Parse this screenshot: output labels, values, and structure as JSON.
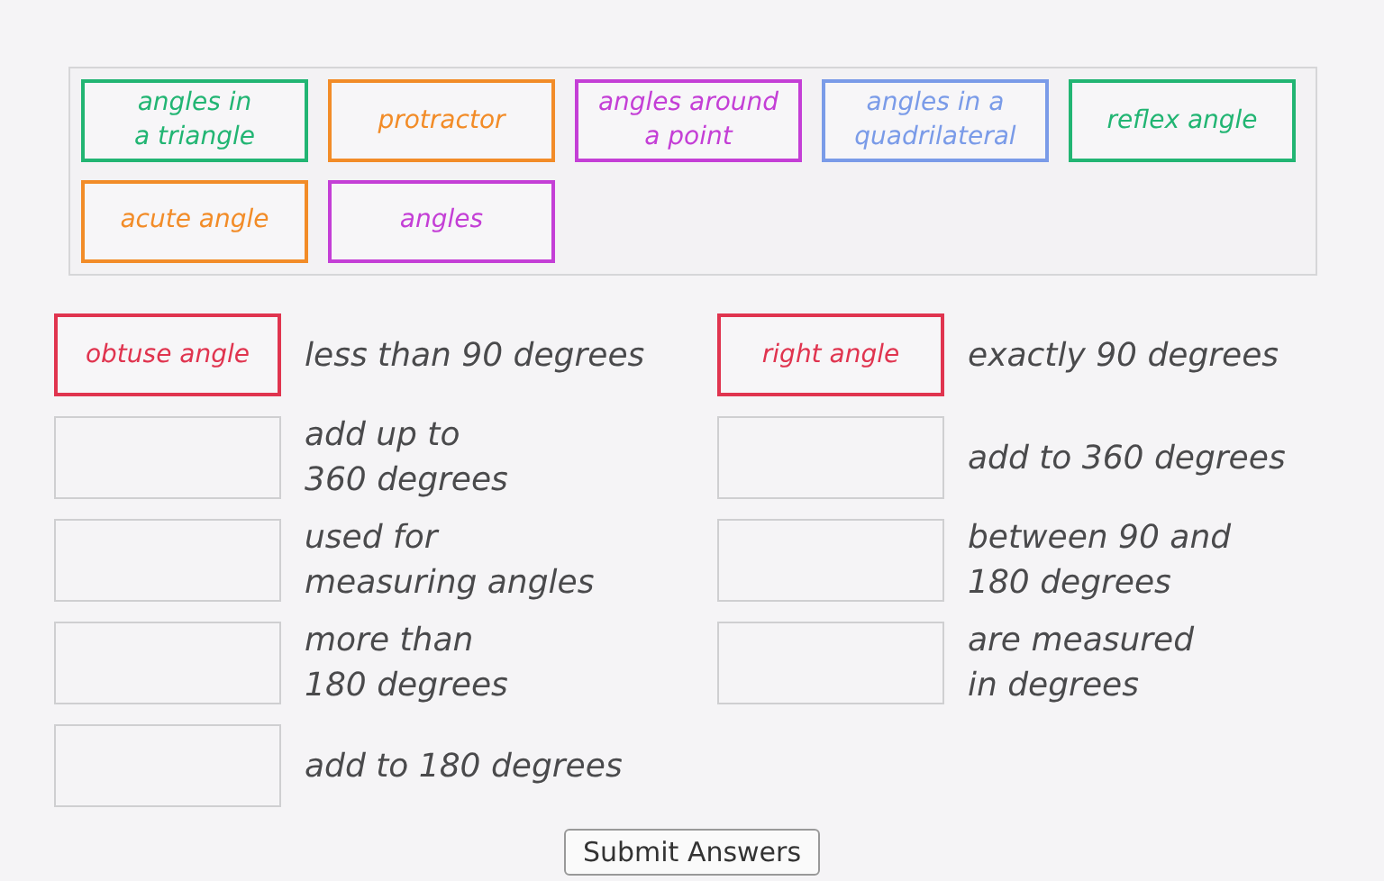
{
  "bank": [
    {
      "label": "angles in\na triangle",
      "color": "#22b573"
    },
    {
      "label": "protractor",
      "color": "#f28c28"
    },
    {
      "label": "angles around\na point",
      "color": "#c43fd6"
    },
    {
      "label": "angles in a\nquadrilateral",
      "color": "#7a9be8"
    },
    {
      "label": "reflex angle",
      "color": "#22b573"
    },
    {
      "label": "acute angle",
      "color": "#f28c28"
    },
    {
      "label": "angles",
      "color": "#c43fd6"
    }
  ],
  "pairs": [
    {
      "answer": {
        "label": "obtuse angle",
        "color": "#e0344f"
      },
      "text": "less than 90 degrees"
    },
    {
      "answer": {
        "label": "right angle",
        "color": "#e0344f"
      },
      "text": "exactly 90 degrees"
    },
    {
      "text": "add up to\n360 degrees"
    },
    {
      "text": "add to 360 degrees"
    },
    {
      "text": "used for\nmeasuring angles"
    },
    {
      "text": "between 90 and\n180 degrees"
    },
    {
      "text": "more than\n180 degrees"
    },
    {
      "text": "are measured\nin degrees"
    },
    {
      "text": "add to 180 degrees"
    }
  ],
  "submit": "Submit Answers"
}
